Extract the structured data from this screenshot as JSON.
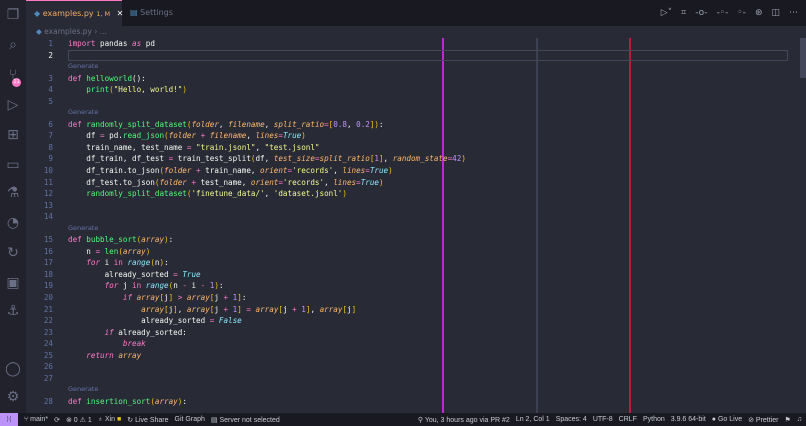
{
  "tabs": [
    {
      "label": "examples.py",
      "status": "1, M"
    },
    {
      "label": "Settings"
    }
  ],
  "breadcrumb": {
    "file": "examples.py",
    "sep": "›",
    "rest": "..."
  },
  "codelens": "Generate",
  "lines": [
    {
      "n": "1",
      "t": [
        [
          "import",
          "k"
        ],
        [
          " pandas ",
          "w"
        ],
        [
          "as",
          "ki"
        ],
        [
          " pd",
          "w"
        ]
      ]
    },
    {
      "n": "2",
      "t": [],
      "cur": true
    },
    {
      "gen": true
    },
    {
      "n": "3",
      "t": [
        [
          "def ",
          "k"
        ],
        [
          "helloworld",
          "f"
        ],
        [
          "():",
          "w"
        ]
      ]
    },
    {
      "n": "4",
      "t": [
        [
          "    ",
          "w"
        ],
        [
          "print",
          "f"
        ],
        [
          "(",
          "pa"
        ],
        [
          "\"Hello, world!\"",
          "s"
        ],
        [
          ")",
          "pa"
        ]
      ]
    },
    {
      "n": "5",
      "t": []
    },
    {
      "gen": true
    },
    {
      "n": "6",
      "t": [
        [
          "def ",
          "k"
        ],
        [
          "randomly_split_dataset",
          "f"
        ],
        [
          "(",
          "pa"
        ],
        [
          "folder",
          "p"
        ],
        [
          ", ",
          "w"
        ],
        [
          "filename",
          "p"
        ],
        [
          ", ",
          "w"
        ],
        [
          "split_ratio",
          "p"
        ],
        [
          "=",
          "o"
        ],
        [
          "[",
          "pa"
        ],
        [
          "0.8",
          "n"
        ],
        [
          ", ",
          "w"
        ],
        [
          "0.2",
          "n"
        ],
        [
          "]",
          "pa"
        ],
        [
          ")",
          "pa"
        ],
        [
          ":",
          "w"
        ]
      ]
    },
    {
      "n": "7",
      "t": [
        [
          "    df ",
          "w"
        ],
        [
          "=",
          "o"
        ],
        [
          " pd.",
          "w"
        ],
        [
          "read_json",
          "f"
        ],
        [
          "(",
          "pa"
        ],
        [
          "folder",
          "p"
        ],
        [
          " + ",
          "o"
        ],
        [
          "filename",
          "p"
        ],
        [
          ", ",
          "w"
        ],
        [
          "lines",
          "p"
        ],
        [
          "=",
          "o"
        ],
        [
          "True",
          "b"
        ],
        [
          ")",
          "pa"
        ]
      ]
    },
    {
      "n": "8",
      "t": [
        [
          "    train_name, test_name ",
          "w"
        ],
        [
          "=",
          "o"
        ],
        [
          " ",
          "w"
        ],
        [
          "\"train.jsonl\"",
          "s"
        ],
        [
          ", ",
          "w"
        ],
        [
          "\"test.jsonl\"",
          "s"
        ]
      ]
    },
    {
      "n": "9",
      "t": [
        [
          "    df_train, df_test ",
          "w"
        ],
        [
          "=",
          "o"
        ],
        [
          " train_test_split",
          "w"
        ],
        [
          "(",
          "pa"
        ],
        [
          "df, ",
          "w"
        ],
        [
          "test_size",
          "p"
        ],
        [
          "=",
          "o"
        ],
        [
          "split_ratio",
          "p"
        ],
        [
          "[",
          "pa"
        ],
        [
          "1",
          "n"
        ],
        [
          "]",
          "pa"
        ],
        [
          ", ",
          "w"
        ],
        [
          "random_state",
          "p"
        ],
        [
          "=",
          "o"
        ],
        [
          "42",
          "n"
        ],
        [
          ")",
          "pa"
        ]
      ]
    },
    {
      "n": "10",
      "t": [
        [
          "    df_train.to_json",
          "w"
        ],
        [
          "(",
          "pa"
        ],
        [
          "folder",
          "p"
        ],
        [
          " + ",
          "o"
        ],
        [
          "train_name, ",
          "w"
        ],
        [
          "orient",
          "p"
        ],
        [
          "=",
          "o"
        ],
        [
          "'records'",
          "s"
        ],
        [
          ", ",
          "w"
        ],
        [
          "lines",
          "p"
        ],
        [
          "=",
          "o"
        ],
        [
          "True",
          "b"
        ],
        [
          ")",
          "pa"
        ]
      ]
    },
    {
      "n": "11",
      "t": [
        [
          "    df_test.to_json",
          "w"
        ],
        [
          "(",
          "pa"
        ],
        [
          "folder",
          "p"
        ],
        [
          " + ",
          "o"
        ],
        [
          "test_name, ",
          "w"
        ],
        [
          "orient",
          "p"
        ],
        [
          "=",
          "o"
        ],
        [
          "'records'",
          "s"
        ],
        [
          ", ",
          "w"
        ],
        [
          "lines",
          "p"
        ],
        [
          "=",
          "o"
        ],
        [
          "True",
          "b"
        ],
        [
          ")",
          "pa"
        ]
      ]
    },
    {
      "n": "12",
      "t": [
        [
          "    ",
          "w"
        ],
        [
          "randomly_split_dataset",
          "f"
        ],
        [
          "(",
          "pa"
        ],
        [
          "'finetune_data/'",
          "s"
        ],
        [
          ", ",
          "w"
        ],
        [
          "'dataset.jsonl'",
          "s"
        ],
        [
          ")",
          "pa"
        ]
      ]
    },
    {
      "n": "13",
      "t": []
    },
    {
      "n": "14",
      "t": []
    },
    {
      "gen": true
    },
    {
      "n": "15",
      "t": [
        [
          "def ",
          "k"
        ],
        [
          "bubble_sort",
          "f"
        ],
        [
          "(",
          "pa"
        ],
        [
          "array",
          "p"
        ],
        [
          ")",
          "pa"
        ],
        [
          ":",
          "w"
        ]
      ]
    },
    {
      "n": "16",
      "t": [
        [
          "    n ",
          "w"
        ],
        [
          "=",
          "o"
        ],
        [
          " ",
          "w"
        ],
        [
          "len",
          "f"
        ],
        [
          "(",
          "pa"
        ],
        [
          "array",
          "p"
        ],
        [
          ")",
          "pa"
        ]
      ]
    },
    {
      "n": "17",
      "t": [
        [
          "    ",
          "w"
        ],
        [
          "for",
          "ki"
        ],
        [
          " i ",
          "w"
        ],
        [
          "in",
          "k"
        ],
        [
          " ",
          "w"
        ],
        [
          "range",
          "b"
        ],
        [
          "(",
          "pa"
        ],
        [
          "n",
          "w"
        ],
        [
          ")",
          "pa"
        ],
        [
          ":",
          "w"
        ]
      ]
    },
    {
      "n": "18",
      "t": [
        [
          "        already_sorted ",
          "w"
        ],
        [
          "=",
          "o"
        ],
        [
          " ",
          "w"
        ],
        [
          "True",
          "b"
        ]
      ]
    },
    {
      "n": "19",
      "t": [
        [
          "        ",
          "w"
        ],
        [
          "for",
          "ki"
        ],
        [
          " j ",
          "w"
        ],
        [
          "in",
          "k"
        ],
        [
          " ",
          "w"
        ],
        [
          "range",
          "b"
        ],
        [
          "(",
          "pa"
        ],
        [
          "n ",
          "w"
        ],
        [
          "-",
          "o"
        ],
        [
          " i ",
          "w"
        ],
        [
          "-",
          "o"
        ],
        [
          " ",
          "w"
        ],
        [
          "1",
          "n"
        ],
        [
          ")",
          "pa"
        ],
        [
          ":",
          "w"
        ]
      ]
    },
    {
      "n": "20",
      "t": [
        [
          "            ",
          "w"
        ],
        [
          "if",
          "ki"
        ],
        [
          " ",
          "w"
        ],
        [
          "array",
          "p"
        ],
        [
          "[",
          "pa"
        ],
        [
          "j",
          "w"
        ],
        [
          "]",
          "pa"
        ],
        [
          " > ",
          "o"
        ],
        [
          "array",
          "p"
        ],
        [
          "[",
          "pa"
        ],
        [
          "j ",
          "w"
        ],
        [
          "+",
          "o"
        ],
        [
          " ",
          "w"
        ],
        [
          "1",
          "n"
        ],
        [
          "]",
          "pa"
        ],
        [
          ":",
          "w"
        ]
      ]
    },
    {
      "n": "21",
      "t": [
        [
          "                ",
          "w"
        ],
        [
          "array",
          "p"
        ],
        [
          "[",
          "pa"
        ],
        [
          "j",
          "w"
        ],
        [
          "]",
          "pa"
        ],
        [
          ", ",
          "w"
        ],
        [
          "array",
          "p"
        ],
        [
          "[",
          "pa"
        ],
        [
          "j ",
          "w"
        ],
        [
          "+",
          "o"
        ],
        [
          " ",
          "w"
        ],
        [
          "1",
          "n"
        ],
        [
          "]",
          "pa"
        ],
        [
          " = ",
          "o"
        ],
        [
          "array",
          "p"
        ],
        [
          "[",
          "pa"
        ],
        [
          "j ",
          "w"
        ],
        [
          "+",
          "o"
        ],
        [
          " ",
          "w"
        ],
        [
          "1",
          "n"
        ],
        [
          "]",
          "pa"
        ],
        [
          ", ",
          "w"
        ],
        [
          "array",
          "p"
        ],
        [
          "[",
          "pa"
        ],
        [
          "j",
          "w"
        ],
        [
          "]",
          "pa"
        ]
      ]
    },
    {
      "n": "22",
      "t": [
        [
          "                already_sorted ",
          "w"
        ],
        [
          "=",
          "o"
        ],
        [
          " ",
          "w"
        ],
        [
          "False",
          "b"
        ]
      ]
    },
    {
      "n": "23",
      "t": [
        [
          "        ",
          "w"
        ],
        [
          "if",
          "ki"
        ],
        [
          " already_sorted:",
          "w"
        ]
      ]
    },
    {
      "n": "24",
      "t": [
        [
          "            ",
          "w"
        ],
        [
          "break",
          "ki"
        ]
      ]
    },
    {
      "n": "25",
      "t": [
        [
          "    ",
          "w"
        ],
        [
          "return",
          "ki"
        ],
        [
          " ",
          "w"
        ],
        [
          "array",
          "p"
        ]
      ]
    },
    {
      "n": "26",
      "t": []
    },
    {
      "n": "27",
      "t": []
    },
    {
      "gen": true
    },
    {
      "n": "28",
      "t": [
        [
          "def ",
          "k"
        ],
        [
          "insertion_sort",
          "f"
        ],
        [
          "(",
          "pa"
        ],
        [
          "array",
          "p"
        ],
        [
          ")",
          "pa"
        ],
        [
          ":",
          "w"
        ]
      ]
    }
  ],
  "status": {
    "branch": "main*",
    "errors": "0",
    "warnings": "1",
    "user": "Xin",
    "liveshare": "Live Share",
    "gitgraph": "Git Graph",
    "server": "Server not selected",
    "blame": "You, 3 hours ago via PR #2",
    "position": "Ln 2, Col 1",
    "spaces": "Spaces: 4",
    "encoding": "UTF-8",
    "eol": "CRLF",
    "language": "Python",
    "interpreter": "3.9.6 64-bit",
    "golive": "Go Live",
    "prettier": "Prettier"
  },
  "colors": {
    "ruler1": "#c026d3",
    "ruler2": "#44475a",
    "ruler3": "#b91c3c",
    "accent": "#bd93f9"
  }
}
